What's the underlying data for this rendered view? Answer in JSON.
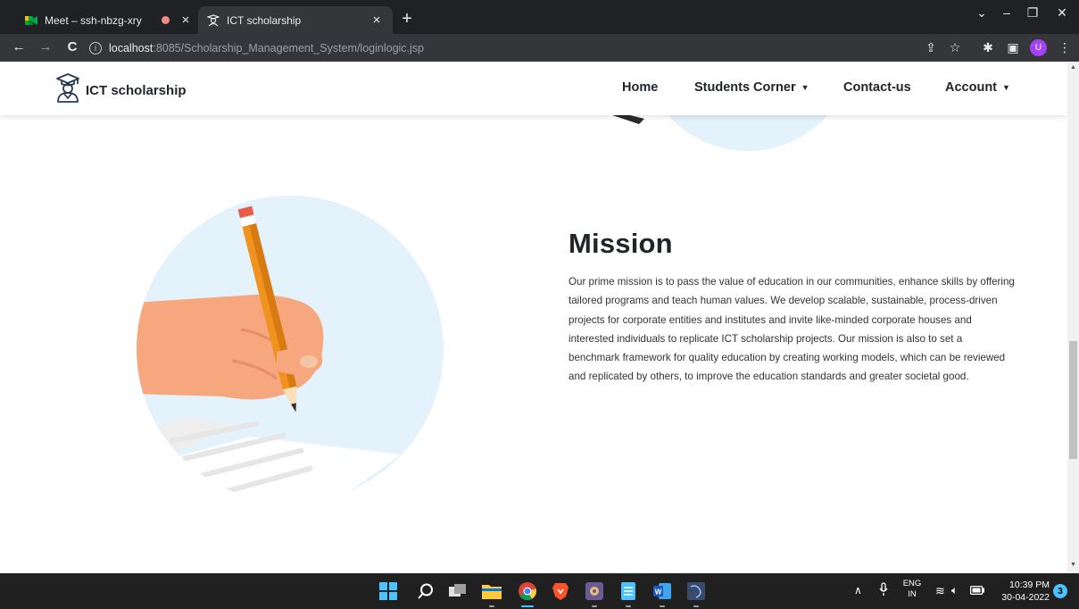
{
  "browser": {
    "tabs": [
      {
        "title": "Meet – ssh-nbzg-xry",
        "favicon": "google-meet-icon",
        "recording": true
      },
      {
        "title": "ICT scholarship",
        "favicon": "graduate-icon",
        "active": true
      }
    ],
    "url": {
      "host": "localhost",
      "path": ":8085/Scholarship_Management_System/loginlogic.jsp"
    },
    "profile_initial": "U"
  },
  "site": {
    "brand": "ICT scholarship",
    "nav": {
      "home": "Home",
      "students_corner": "Students Corner",
      "contact": "Contact-us",
      "account": "Account"
    }
  },
  "mission": {
    "heading": "Mission",
    "body": "Our prime mission is to pass the value of education in our communities, enhance skills by offering tailored programs and teach human values. We develop scalable, sustainable, process-driven projects for corporate entities and institutes and invite like-minded corporate houses and interested individuals to replicate ICT scholarship projects. Our mission is also to set a benchmark framework for quality education by creating working models, which can be reviewed and replicated by others, to improve the education standards and greater societal good."
  },
  "taskbar": {
    "language": {
      "line1": "ENG",
      "line2": "IN"
    },
    "time": "10:39 PM",
    "date": "30-04-2022",
    "notifications": "3"
  },
  "colors": {
    "circle": "#e3f2fb",
    "pencil": "#f0921e",
    "hand": "#f7a77e",
    "chrome_dark": "#202124",
    "accent": "#4cc2ff"
  }
}
